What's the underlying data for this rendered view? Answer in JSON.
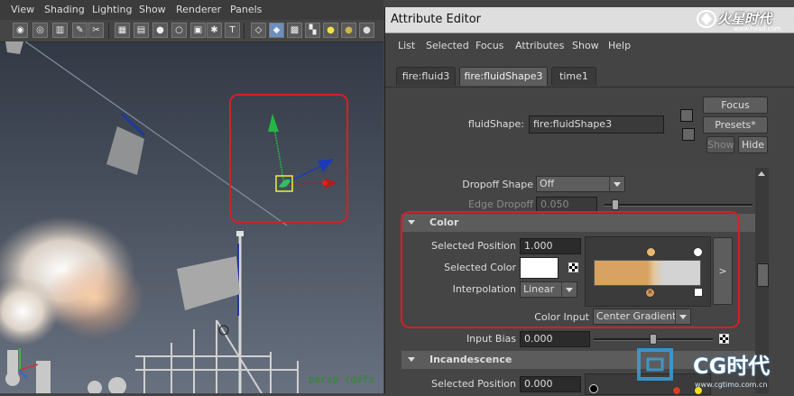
{
  "viewport": {
    "menu": [
      "View",
      "Shading",
      "Lighting",
      "Show",
      "Renderer",
      "Panels"
    ],
    "camera_label": "persp (defa"
  },
  "attribute_editor": {
    "title": "Attribute Editor",
    "menu": [
      "List",
      "Selected",
      "Focus",
      "Attributes",
      "Show",
      "Help"
    ],
    "tabs": [
      {
        "label": "fire:fluid3",
        "active": false
      },
      {
        "label": "fire:fluidShape3",
        "active": true
      },
      {
        "label": "time1",
        "active": false
      }
    ],
    "node_label": "fluidShape:",
    "node_name": "fire:fluidShape3",
    "buttons": {
      "focus": "Focus",
      "presets": "Presets*",
      "show": "Show",
      "hide": "Hide"
    },
    "dropoff_shape": {
      "label": "Dropoff Shape",
      "value": "Off"
    },
    "edge_dropoff": {
      "label": "Edge Dropoff",
      "value": "0.050",
      "fraction": 0.05
    },
    "color_section": {
      "header": "Color",
      "selected_position_label": "Selected Position",
      "selected_position": "1.000",
      "selected_color_label": "Selected Color",
      "selected_color": "#ffffff",
      "interpolation_label": "Interpolation",
      "interpolation": "Linear",
      "gradient_colors": [
        "#d7a262",
        "#e3c79a",
        "#d3d3d3"
      ],
      "expand_button": ">",
      "color_input_label": "Color Input",
      "color_input": "Center Gradient"
    },
    "input_bias": {
      "label": "Input Bias",
      "value": "0.000",
      "fraction": 0.5
    },
    "incandescence_section": {
      "header": "Incandescence",
      "selected_position_label": "Selected Position",
      "selected_position": "0.000"
    }
  },
  "watermarks": {
    "top": "火星时代",
    "top_url": "www.hxsd.com",
    "bottom": "CG时代",
    "bottom_url": "www.cgtimo.com.cn"
  },
  "colors": {
    "highlight_red": "#d61f27",
    "panel_bg": "#444444",
    "title_bar": "#dedede"
  }
}
